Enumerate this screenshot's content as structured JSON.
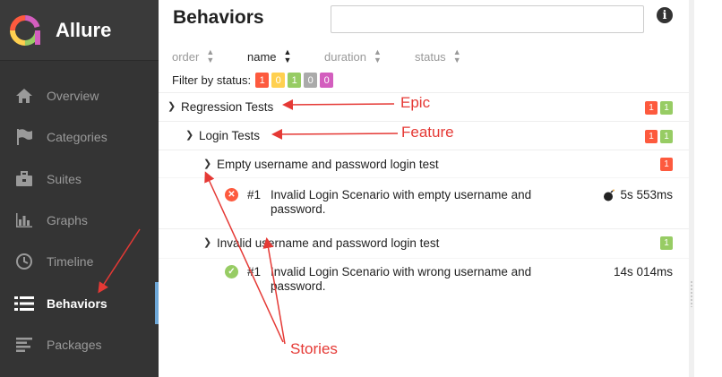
{
  "app": {
    "title": "Allure"
  },
  "sidebar": {
    "items": [
      {
        "label": "Overview",
        "icon": "home-icon"
      },
      {
        "label": "Categories",
        "icon": "flag-icon"
      },
      {
        "label": "Suites",
        "icon": "briefcase-icon"
      },
      {
        "label": "Graphs",
        "icon": "bar-chart-icon"
      },
      {
        "label": "Timeline",
        "icon": "clock-icon"
      },
      {
        "label": "Behaviors",
        "icon": "list-icon",
        "active": true
      },
      {
        "label": "Packages",
        "icon": "align-left-icon"
      }
    ]
  },
  "pane": {
    "title": "Behaviors",
    "search": {
      "value": "",
      "placeholder": ""
    },
    "info_icon": "i",
    "sort": {
      "order": "order",
      "name": "name",
      "duration": "duration",
      "status": "status"
    },
    "filter": {
      "label": "Filter by status:",
      "counts": {
        "failed": "1",
        "broken": "0",
        "passed": "1",
        "skipped": "0",
        "unknown": "0"
      }
    },
    "tree": {
      "epic": {
        "name": "Regression Tests",
        "failed": "1",
        "passed": "1"
      },
      "feature": {
        "name": "Login Tests",
        "failed": "1",
        "passed": "1"
      },
      "stories": [
        {
          "name": "Empty username and password login test",
          "failed": "1",
          "test": {
            "num": "#1",
            "name": "Invalid Login Scenario with empty username and password.",
            "duration": "5s 553ms",
            "status": "failed"
          }
        },
        {
          "name": "Invalid username and password login test",
          "passed": "1",
          "test": {
            "num": "#1",
            "name": "Invalid Login Scenario with wrong username and password.",
            "duration": "14s 014ms",
            "status": "passed"
          }
        }
      ]
    }
  },
  "annotations": {
    "epic": "Epic",
    "feature": "Feature",
    "stories": "Stories"
  },
  "colors": {
    "sidebar_bg": "#343434",
    "failed": "#fd5a3e",
    "broken": "#ffd050",
    "passed": "#97cc64",
    "skipped": "#aaaaaa",
    "unknown": "#d35ebe",
    "annotation": "#e53935"
  }
}
